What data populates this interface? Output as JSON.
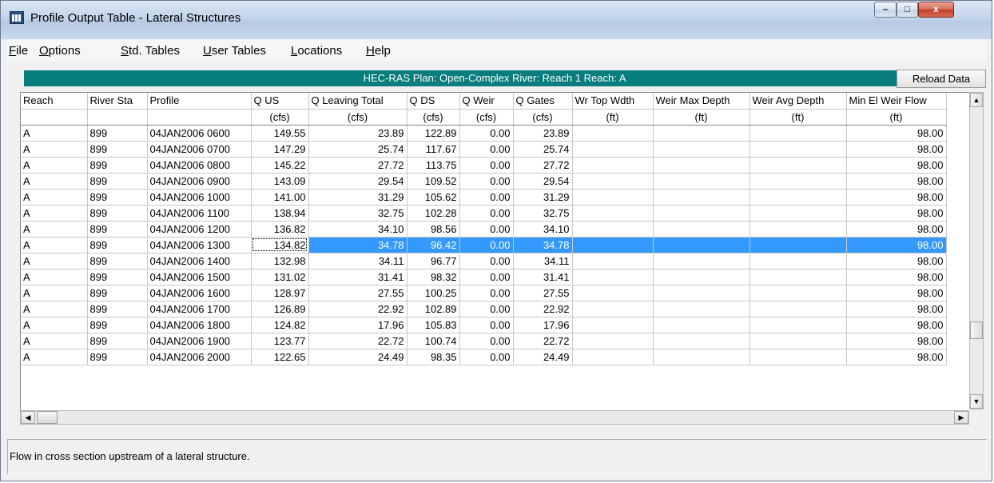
{
  "window": {
    "title": "Profile Output Table - Lateral Structures",
    "minimize": "–",
    "maximize": "□",
    "close": "x"
  },
  "menu": [
    {
      "underline": "F",
      "rest": "ile"
    },
    {
      "underline": "O",
      "rest": "ptions"
    },
    {
      "underline": "S",
      "rest": "td. Tables"
    },
    {
      "underline": "U",
      "rest": "ser Tables"
    },
    {
      "underline": "L",
      "rest": "ocations"
    },
    {
      "underline": "H",
      "rest": "elp"
    }
  ],
  "plan_bar": "HEC-RAS  Plan: Open-Complex   River: Reach 1   Reach: A",
  "reload_button": "Reload Data",
  "columns": [
    {
      "name": "Reach",
      "unit": ""
    },
    {
      "name": "River Sta",
      "unit": ""
    },
    {
      "name": "Profile",
      "unit": ""
    },
    {
      "name": "Q US",
      "unit": "(cfs)"
    },
    {
      "name": "Q Leaving Total",
      "unit": "(cfs)"
    },
    {
      "name": "Q DS",
      "unit": "(cfs)"
    },
    {
      "name": "Q Weir",
      "unit": "(cfs)"
    },
    {
      "name": "Q Gates",
      "unit": "(cfs)"
    },
    {
      "name": "Wr Top Wdth",
      "unit": "(ft)"
    },
    {
      "name": "Weir Max Depth",
      "unit": "(ft)"
    },
    {
      "name": "Weir Avg Depth",
      "unit": "(ft)"
    },
    {
      "name": "Min El Weir Flow",
      "unit": "(ft)"
    }
  ],
  "rows": [
    [
      "A",
      "899",
      "04JAN2006 0600",
      "149.55",
      "23.89",
      "122.89",
      "0.00",
      "23.89",
      "",
      "",
      "",
      "98.00"
    ],
    [
      "A",
      "899",
      "04JAN2006 0700",
      "147.29",
      "25.74",
      "117.67",
      "0.00",
      "25.74",
      "",
      "",
      "",
      "98.00"
    ],
    [
      "A",
      "899",
      "04JAN2006 0800",
      "145.22",
      "27.72",
      "113.75",
      "0.00",
      "27.72",
      "",
      "",
      "",
      "98.00"
    ],
    [
      "A",
      "899",
      "04JAN2006 0900",
      "143.09",
      "29.54",
      "109.52",
      "0.00",
      "29.54",
      "",
      "",
      "",
      "98.00"
    ],
    [
      "A",
      "899",
      "04JAN2006 1000",
      "141.00",
      "31.29",
      "105.62",
      "0.00",
      "31.29",
      "",
      "",
      "",
      "98.00"
    ],
    [
      "A",
      "899",
      "04JAN2006 1100",
      "138.94",
      "32.75",
      "102.28",
      "0.00",
      "32.75",
      "",
      "",
      "",
      "98.00"
    ],
    [
      "A",
      "899",
      "04JAN2006 1200",
      "136.82",
      "34.10",
      "98.56",
      "0.00",
      "34.10",
      "",
      "",
      "",
      "98.00"
    ],
    [
      "A",
      "899",
      "04JAN2006 1300",
      "134.82",
      "34.78",
      "96.42",
      "0.00",
      "34.78",
      "",
      "",
      "",
      "98.00"
    ],
    [
      "A",
      "899",
      "04JAN2006 1400",
      "132.98",
      "34.11",
      "96.77",
      "0.00",
      "34.11",
      "",
      "",
      "",
      "98.00"
    ],
    [
      "A",
      "899",
      "04JAN2006 1500",
      "131.02",
      "31.41",
      "98.32",
      "0.00",
      "31.41",
      "",
      "",
      "",
      "98.00"
    ],
    [
      "A",
      "899",
      "04JAN2006 1600",
      "128.97",
      "27.55",
      "100.25",
      "0.00",
      "27.55",
      "",
      "",
      "",
      "98.00"
    ],
    [
      "A",
      "899",
      "04JAN2006 1700",
      "126.89",
      "22.92",
      "102.89",
      "0.00",
      "22.92",
      "",
      "",
      "",
      "98.00"
    ],
    [
      "A",
      "899",
      "04JAN2006 1800",
      "124.82",
      "17.96",
      "105.83",
      "0.00",
      "17.96",
      "",
      "",
      "",
      "98.00"
    ],
    [
      "A",
      "899",
      "04JAN2006 1900",
      "123.77",
      "22.72",
      "100.74",
      "0.00",
      "22.72",
      "",
      "",
      "",
      "98.00"
    ],
    [
      "A",
      "899",
      "04JAN2006 2000",
      "122.65",
      "24.49",
      "98.35",
      "0.00",
      "24.49",
      "",
      "",
      "",
      "98.00"
    ]
  ],
  "selected_row": 7,
  "selection_color": "#3399ff",
  "status_text": "Flow in cross section upstream of a lateral structure.",
  "scroll_icons": {
    "up": "▲",
    "down": "▼",
    "left": "◀",
    "right": "▶"
  }
}
